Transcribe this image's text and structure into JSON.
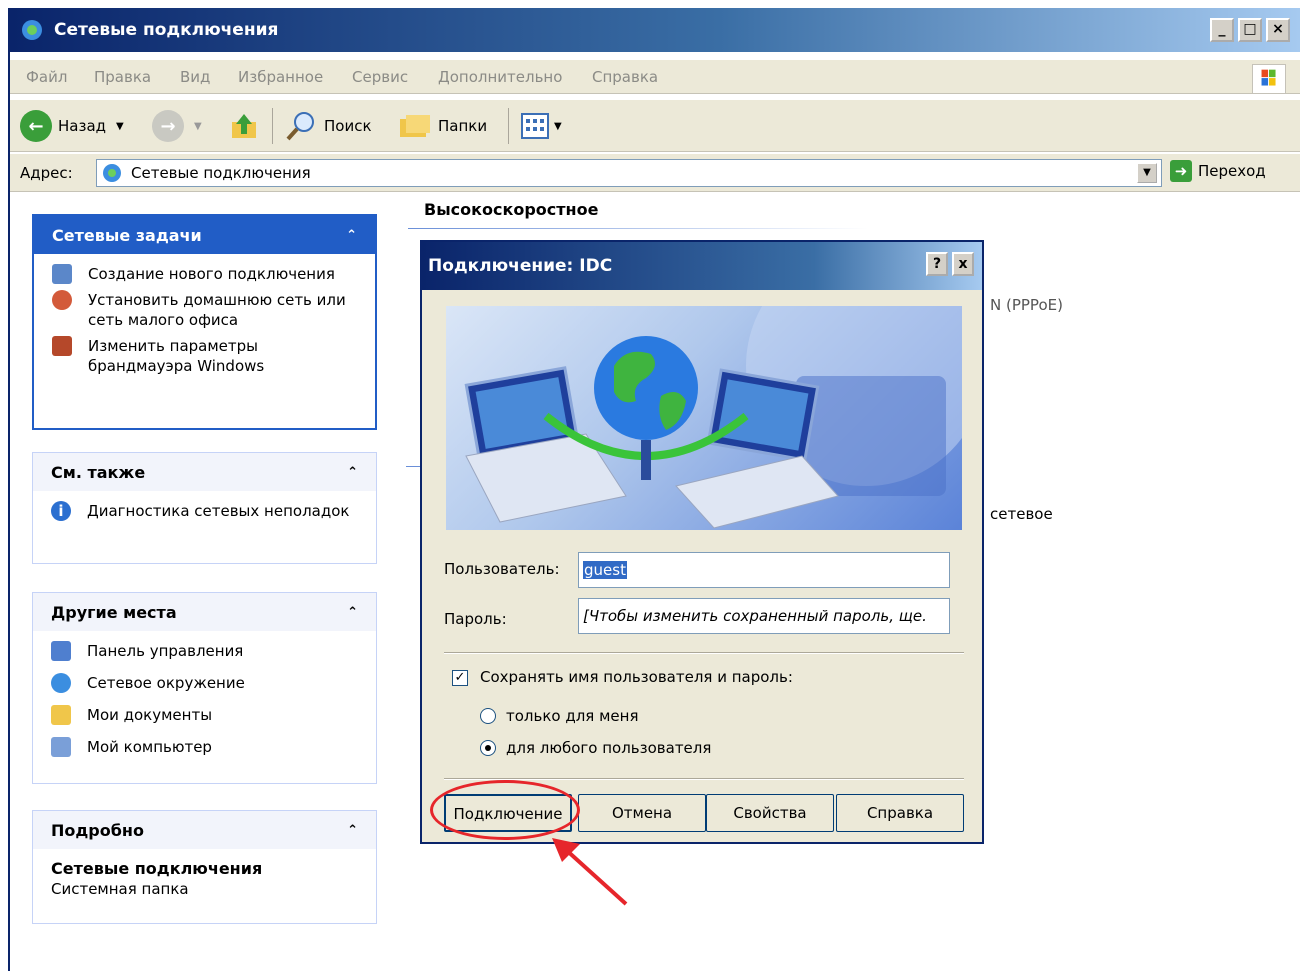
{
  "window": {
    "title": "Сетевые подключения"
  },
  "menu": [
    "Файл",
    "Правка",
    "Вид",
    "Избранное",
    "Сервис",
    "Дополнительно",
    "Справка"
  ],
  "toolbar": {
    "back": "Назад",
    "search": "Поиск",
    "folders": "Папки"
  },
  "address": {
    "label": "Адрес:",
    "value": "Сетевые подключения",
    "go": "Переход"
  },
  "taskpane": {
    "network_tasks": {
      "title": "Сетевые задачи",
      "items": [
        "Создание нового подключения",
        "Установить домашнюю сеть или сеть малого офиса",
        "Изменить параметры брандмауэра Windows"
      ]
    },
    "see_also": {
      "title": "См. также",
      "items": [
        "Диагностика сетевых неполадок"
      ]
    },
    "other_places": {
      "title": "Другие места",
      "items": [
        "Панель управления",
        "Сетевое окружение",
        "Мои документы",
        "Мой компьютер"
      ]
    },
    "details": {
      "title": "Подробно",
      "name": "Сетевые подключения",
      "type": "Системная папка"
    }
  },
  "content": {
    "group_title": "Высокоскоростное",
    "partial_pppoe": "N (PPPoE)",
    "partial_network": "сетевое"
  },
  "dialog": {
    "title": "Подключение: IDC",
    "help_btn": "?",
    "close_btn": "x",
    "user_label": "Пользователь:",
    "user_value": "guest",
    "password_label": "Пароль:",
    "password_value": "[Чтобы изменить сохраненный пароль, ще.",
    "save_label": "Сохранять имя пользователя и пароль:",
    "radio_me": "только для меня",
    "radio_any": "для любого пользователя",
    "btn_connect": "Подключение",
    "btn_cancel": "Отмена",
    "btn_props": "Свойства",
    "btn_help": "Справка"
  },
  "colors": {
    "title_blue": "#0a246a",
    "task_blue": "#215dc6",
    "callout_red": "#e6262b"
  }
}
